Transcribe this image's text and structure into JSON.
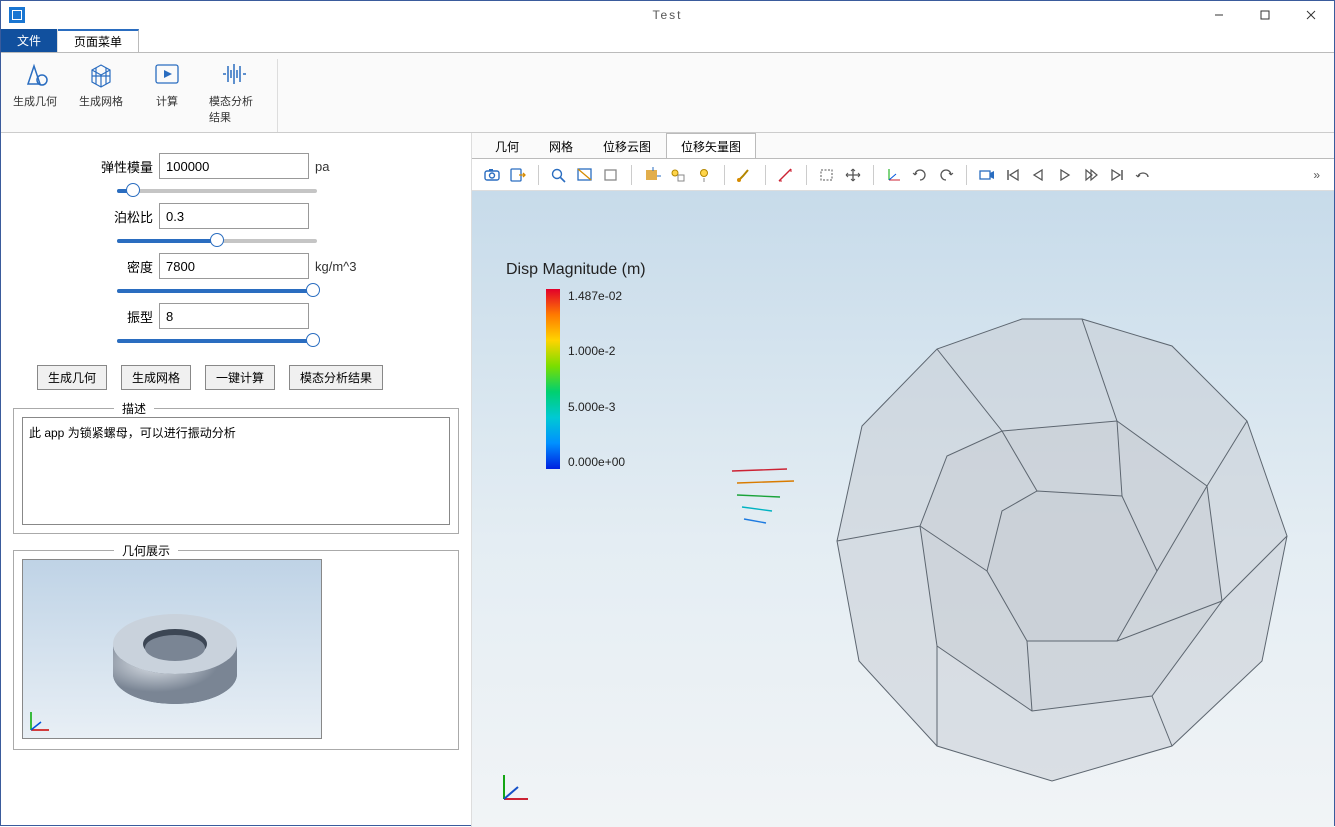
{
  "window": {
    "title": "Test"
  },
  "menu": {
    "file": "文件",
    "page": "页面菜单"
  },
  "ribbon": {
    "genGeom": "生成几何",
    "genMesh": "生成网格",
    "compute": "计算",
    "modalResult": "模态分析结果"
  },
  "params": {
    "modulus": {
      "label": "弹性模量",
      "value": "100000",
      "unit": "pa",
      "pct": 8
    },
    "poisson": {
      "label": "泊松比",
      "value": "0.3",
      "unit": "",
      "pct": 50
    },
    "density": {
      "label": "密度",
      "value": "7800",
      "unit": "kg/m^3",
      "pct": 98
    },
    "mode": {
      "label": "振型",
      "value": "8",
      "unit": "",
      "pct": 98
    }
  },
  "actions": {
    "genGeom": "生成几何",
    "genMesh": "生成网格",
    "compute": "一键计算",
    "modalResult": "模态分析结果"
  },
  "desc": {
    "legend": "描述",
    "text": "此 app 为锁紧螺母，可以进行振动分析"
  },
  "geoPreview": {
    "legend": "几何展示"
  },
  "rtabs": {
    "geom": "几何",
    "mesh": "网格",
    "contour": "位移云图",
    "vector": "位移矢量图"
  },
  "legend3d": {
    "title": "Disp Magnitude (m)",
    "ticks": [
      "1.487e-02",
      "1.000e-2",
      "5.000e-3",
      "0.000e+00"
    ]
  },
  "chart_data": {
    "type": "scalar_legend",
    "title": "Disp Magnitude (m)",
    "min": 0.0,
    "max": 0.01487,
    "ticks": [
      0.01487,
      0.01,
      0.005,
      0.0
    ]
  }
}
